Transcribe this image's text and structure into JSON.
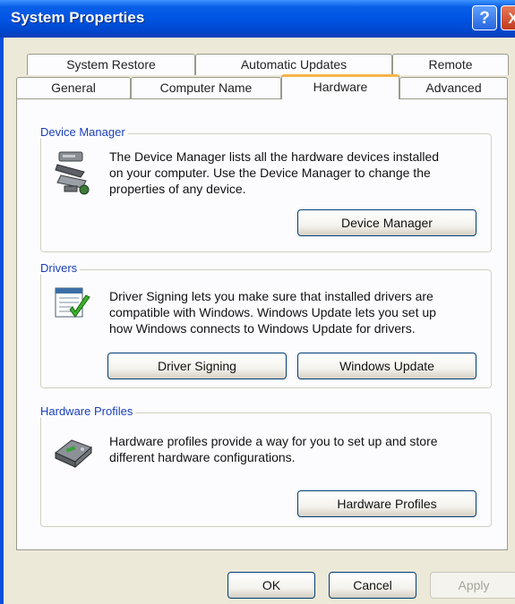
{
  "window": {
    "title": "System Properties"
  },
  "titlebar": {
    "help_glyph": "?",
    "close_glyph": "X"
  },
  "tabs": {
    "row1": [
      {
        "label": "System Restore"
      },
      {
        "label": "Automatic Updates"
      },
      {
        "label": "Remote"
      }
    ],
    "row2": [
      {
        "label": "General"
      },
      {
        "label": "Computer Name"
      },
      {
        "label": "Hardware"
      },
      {
        "label": "Advanced"
      }
    ],
    "active": "Hardware"
  },
  "device_manager": {
    "legend": "Device Manager",
    "line1": "The Device Manager lists all the hardware devices installed",
    "line2": "on your computer. Use the Device Manager to change the",
    "line3": "properties of any device.",
    "button": "Device Manager",
    "icon": "device-manager-icon"
  },
  "drivers": {
    "legend": "Drivers",
    "line1": "Driver Signing lets you make sure that installed drivers are",
    "line2": "compatible with Windows. Windows Update lets you set up",
    "line3": "how Windows connects to Windows Update for drivers.",
    "signing_button": "Driver Signing",
    "update_button": "Windows Update",
    "icon": "driver-signing-icon"
  },
  "hardware_profiles": {
    "legend": "Hardware Profiles",
    "line1": "Hardware profiles provide a way for you to set up and store",
    "line2": "different hardware configurations.",
    "button": "Hardware Profiles",
    "icon": "hardware-profiles-icon"
  },
  "footer": {
    "ok": "OK",
    "cancel": "Cancel",
    "apply": "Apply"
  },
  "colors": {
    "titlebar": "#0054e3",
    "face": "#ece9d8",
    "active_tab": "#f7b34a",
    "legend": "#1a3fb8"
  }
}
